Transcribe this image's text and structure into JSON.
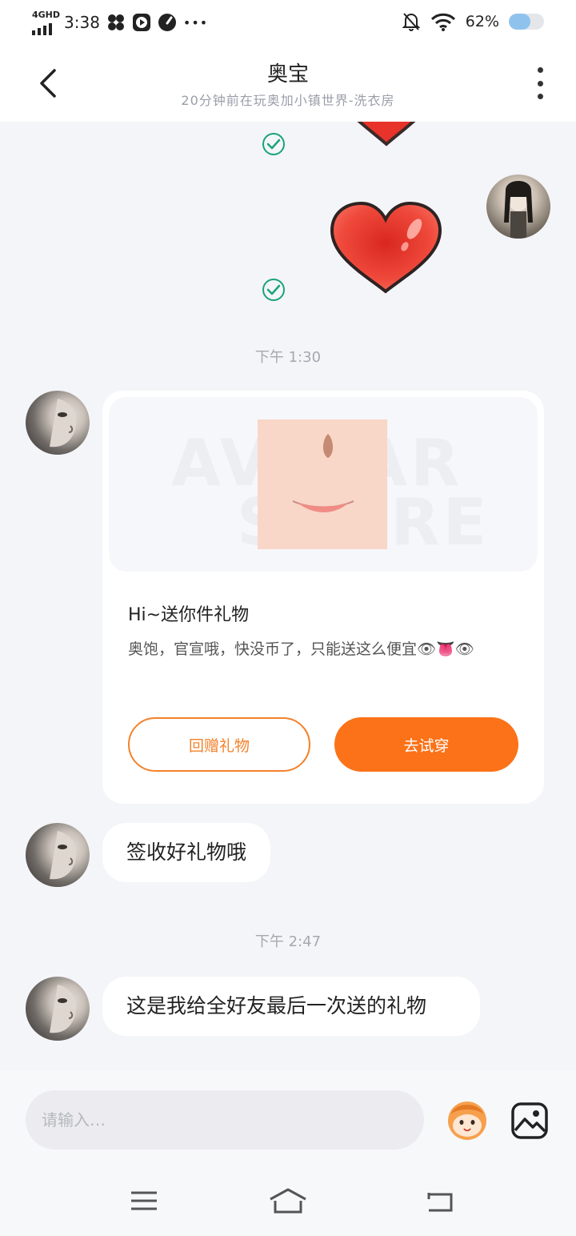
{
  "status_bar": {
    "network": "4GHD",
    "time": "3:38",
    "battery_percent": "62%",
    "battery_level": 0.62,
    "icons": [
      "signal-icon",
      "pinwheel-icon",
      "play-icon",
      "speed-icon",
      "more-dots-icon",
      "mute-bell-icon",
      "wifi-icon",
      "battery-icon"
    ],
    "dots": "•••"
  },
  "header": {
    "title": "奥宝",
    "subtitle": "20分钟前在玩奥加小镇世界-洗衣房"
  },
  "messages": {
    "time_1": "下午 1:30",
    "gift_card": {
      "watermark_line1": "AVATAR",
      "watermark_line2": "STORE",
      "title": "Hi~送你件礼物",
      "description": "奥饱，官宣哦，快没币了，只能送这么便宜👁👅👁",
      "return_gift_label": "回赠礼物",
      "try_on_label": "去试穿"
    },
    "bubble_1": "签收好礼物哦",
    "time_2": "下午 2:47",
    "bubble_2": "这是我给全好友最后一次送的礼物"
  },
  "input": {
    "placeholder": "请输入…"
  },
  "colors": {
    "accent": "#fb7218",
    "check": "#1aa37a",
    "heart": "#e8332a",
    "background": "#f4f5f9"
  }
}
